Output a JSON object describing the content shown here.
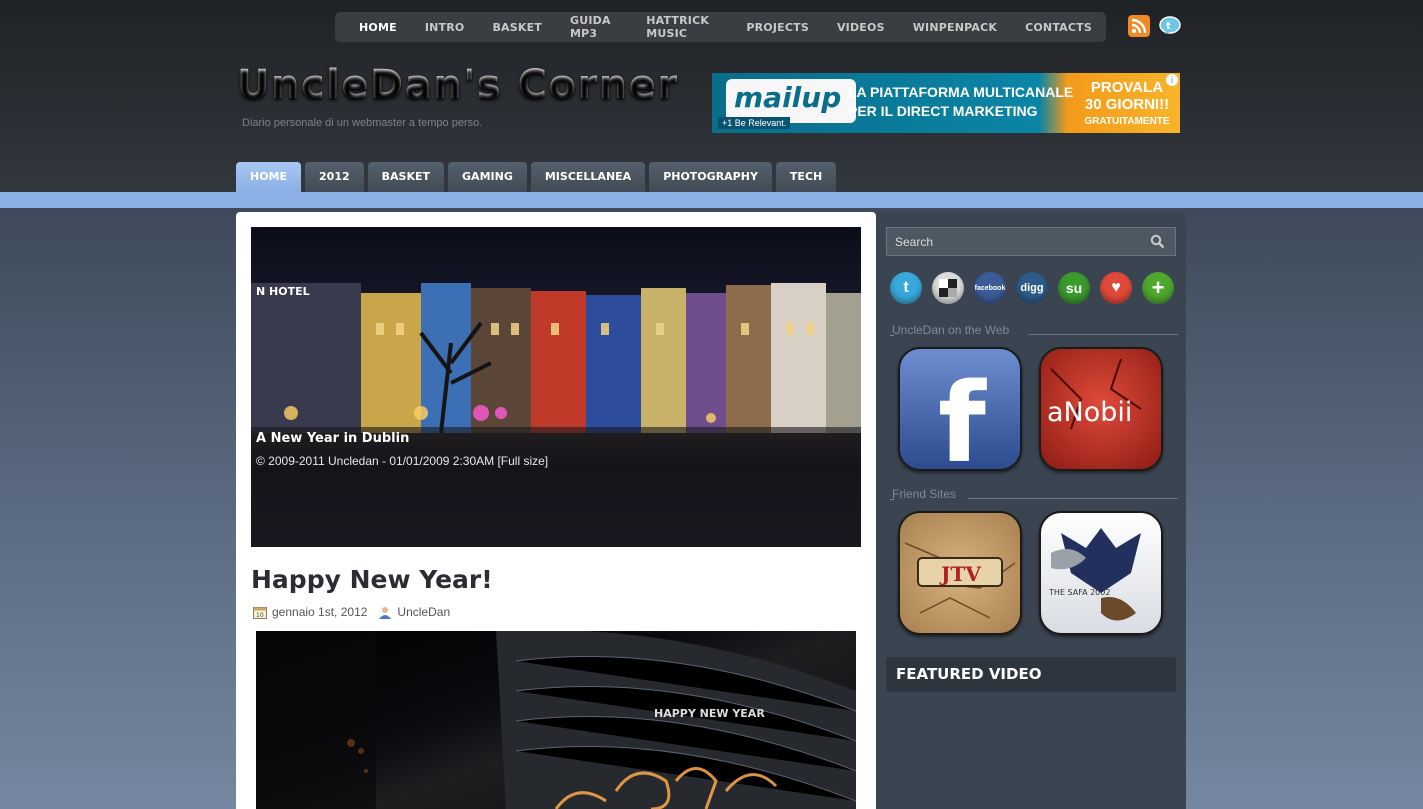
{
  "top_nav": {
    "items": [
      "HOME",
      "INTRO",
      "BASKET",
      "GUIDA MP3",
      "HATTRICK MUSIC",
      "PROJECTS",
      "VIDEOS",
      "WINPENPACK",
      "CONTACTS"
    ]
  },
  "header": {
    "title": "UncleDan's Corner",
    "tagline": "Diario personale di un webmaster a tempo perso."
  },
  "banner": {
    "brand": "mailup",
    "brand_sub": "+1 Be Relevant.",
    "tagline_line1": "LA PIATTAFORMA MULTICANALE",
    "tagline_line2": "PER IL DIRECT MARKETING",
    "cta_line1": "PROVALA",
    "cta_line2": "30 GIORNI!!",
    "cta_line3": "GRATUITAMENTE",
    "info": "i"
  },
  "category_nav": {
    "items": [
      "HOME",
      "2012",
      "BASKET",
      "GAMING",
      "MISCELLANEA",
      "PHOTOGRAPHY",
      "TECH"
    ]
  },
  "slider": {
    "caption_title": "A New Year in Dublin",
    "caption_sub": "© 2009-2011 Uncledan - 01/01/2009 2:30AM [Full size]",
    "sign_text": "N HOTEL"
  },
  "post": {
    "title": "Happy New Year!",
    "date": "gennaio 1st, 2012",
    "author": "UncleDan",
    "image_text": "HAPPY NEW YEAR"
  },
  "sidebar": {
    "search_placeholder": "Search",
    "social": [
      {
        "name": "twitter-icon",
        "label": "t",
        "color": "#39a9db"
      },
      {
        "name": "delicious-icon",
        "label": "",
        "color": "#dcdcdc"
      },
      {
        "name": "facebook-icon",
        "label": "facebook",
        "color": "#3b5b99"
      },
      {
        "name": "digg-icon",
        "label": "digg",
        "color": "#2e5c8a"
      },
      {
        "name": "stumbleupon-icon",
        "label": "su",
        "color": "#3a9a2c"
      },
      {
        "name": "favorite-icon",
        "label": "♥",
        "color": "#e04a3a"
      },
      {
        "name": "add-icon",
        "label": "+",
        "color": "#4fa830"
      }
    ],
    "web_section_label": "UncleDan on the Web",
    "friend_section_label": "Friend Sites",
    "facebook_label": "f",
    "anobii_label": "aNobii",
    "jtv_label": "JTV",
    "safa_label": "THE SAFA 2002",
    "featured_video_label": "FEATURED VIDEO"
  },
  "colors": {
    "accent_blue": "#8ab0e6",
    "header_bg": "#2b2f34",
    "sidebar_bg": "#3b4551"
  }
}
